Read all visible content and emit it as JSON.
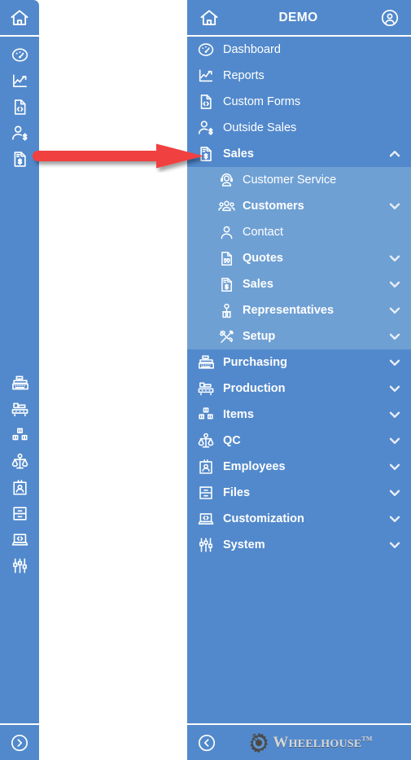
{
  "app": {
    "title": "DEMO",
    "accent_blue": "#5289cc",
    "submenu_blue": "#6fa0d4",
    "arrow_color": "#f04040",
    "logo_text_color": "#d6d6d6"
  },
  "header": {
    "home_icon": "home-icon",
    "title": "DEMO",
    "account_icon": "user-circle-icon"
  },
  "rail": {
    "home_icon": "home-icon",
    "top_items": [
      {
        "icon": "gauge-icon",
        "name": "dashboard"
      },
      {
        "icon": "line-chart-icon",
        "name": "reports"
      },
      {
        "icon": "code-document-icon",
        "name": "custom-forms"
      },
      {
        "icon": "person-dollar-icon",
        "name": "outside-sales"
      },
      {
        "icon": "invoice-dollar-icon",
        "name": "sales",
        "active": true
      }
    ],
    "bottom_items": [
      {
        "icon": "cash-register-icon",
        "name": "purchasing"
      },
      {
        "icon": "conveyor-icon",
        "name": "production"
      },
      {
        "icon": "boxes-icon",
        "name": "items"
      },
      {
        "icon": "scales-icon",
        "name": "qc"
      },
      {
        "icon": "id-badge-icon",
        "name": "employees"
      },
      {
        "icon": "file-cabinet-icon",
        "name": "files"
      },
      {
        "icon": "laptop-code-icon",
        "name": "customization"
      },
      {
        "icon": "sliders-icon",
        "name": "system"
      }
    ],
    "collapse_icon": "chevron-right-circle-icon"
  },
  "menu": {
    "items": [
      {
        "label": "Dashboard",
        "icon": "gauge-icon",
        "bold": false,
        "chevron": "none",
        "level": 0
      },
      {
        "label": "Reports",
        "icon": "line-chart-icon",
        "bold": false,
        "chevron": "none",
        "level": 0
      },
      {
        "label": "Custom Forms",
        "icon": "code-document-icon",
        "bold": false,
        "chevron": "none",
        "level": 0
      },
      {
        "label": "Outside Sales",
        "icon": "person-dollar-icon",
        "bold": false,
        "chevron": "none",
        "level": 0
      },
      {
        "label": "Sales",
        "icon": "invoice-dollar-icon",
        "bold": true,
        "chevron": "up",
        "level": 0,
        "expanded": true
      },
      {
        "label": "Customer Service",
        "icon": "agent-headset-icon",
        "bold": false,
        "chevron": "none",
        "level": 1
      },
      {
        "label": "Customers",
        "icon": "people-group-icon",
        "bold": true,
        "chevron": "down",
        "level": 1
      },
      {
        "label": "Contact",
        "icon": "person-icon",
        "bold": false,
        "chevron": "none",
        "level": 1
      },
      {
        "label": "Quotes",
        "icon": "quote-document-icon",
        "bold": true,
        "chevron": "down",
        "level": 1
      },
      {
        "label": "Sales",
        "icon": "invoice-dollar-icon",
        "bold": true,
        "chevron": "down",
        "level": 1
      },
      {
        "label": "Representatives",
        "icon": "rep-person-icon",
        "bold": true,
        "chevron": "down",
        "level": 1
      },
      {
        "label": "Setup",
        "icon": "tools-icon",
        "bold": true,
        "chevron": "down",
        "level": 1
      },
      {
        "label": "Purchasing",
        "icon": "cash-register-icon",
        "bold": true,
        "chevron": "down",
        "level": 0
      },
      {
        "label": "Production",
        "icon": "conveyor-icon",
        "bold": true,
        "chevron": "down",
        "level": 0
      },
      {
        "label": "Items",
        "icon": "boxes-icon",
        "bold": true,
        "chevron": "down",
        "level": 0
      },
      {
        "label": "QC",
        "icon": "scales-icon",
        "bold": true,
        "chevron": "down",
        "level": 0
      },
      {
        "label": "Employees",
        "icon": "id-badge-icon",
        "bold": true,
        "chevron": "down",
        "level": 0
      },
      {
        "label": "Files",
        "icon": "file-cabinet-icon",
        "bold": true,
        "chevron": "down",
        "level": 0
      },
      {
        "label": "Customization",
        "icon": "laptop-code-icon",
        "bold": true,
        "chevron": "down",
        "level": 0
      },
      {
        "label": "System",
        "icon": "sliders-icon",
        "bold": true,
        "chevron": "down",
        "level": 0
      }
    ]
  },
  "footer": {
    "collapse_icon": "chevron-left-circle-icon",
    "logo_main": "HEELHOUSE",
    "logo_initial": "W",
    "logo_tm": "TM"
  },
  "annotation": {
    "type": "arrow",
    "points_to": "Sales",
    "color": "#f04040"
  }
}
